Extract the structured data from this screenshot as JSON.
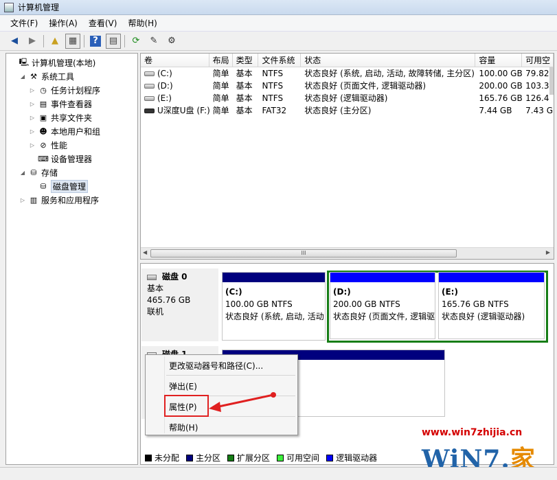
{
  "window": {
    "title": "计算机管理"
  },
  "menu": [
    "文件(F)",
    "操作(A)",
    "查看(V)",
    "帮助(H)"
  ],
  "tree": [
    {
      "label": "计算机管理(本地)",
      "indent": 0,
      "arrow": "",
      "icon": "computer-icon"
    },
    {
      "label": "系统工具",
      "indent": 1,
      "arrow": "◢",
      "icon": "tools-icon"
    },
    {
      "label": "任务计划程序",
      "indent": 2,
      "arrow": "▷",
      "icon": "clock-icon"
    },
    {
      "label": "事件查看器",
      "indent": 2,
      "arrow": "▷",
      "icon": "event-viewer-icon"
    },
    {
      "label": "共享文件夹",
      "indent": 2,
      "arrow": "▷",
      "icon": "shared-folder-icon"
    },
    {
      "label": "本地用户和组",
      "indent": 2,
      "arrow": "▷",
      "icon": "users-icon"
    },
    {
      "label": "性能",
      "indent": 2,
      "arrow": "▷",
      "icon": "performance-icon"
    },
    {
      "label": "设备管理器",
      "indent": 2,
      "arrow": "",
      "icon": "device-manager-icon"
    },
    {
      "label": "存储",
      "indent": 1,
      "arrow": "◢",
      "icon": "storage-icon"
    },
    {
      "label": "磁盘管理",
      "indent": 2,
      "arrow": "",
      "icon": "disk-management-icon",
      "selected": true
    },
    {
      "label": "服务和应用程序",
      "indent": 1,
      "arrow": "▷",
      "icon": "services-icon"
    }
  ],
  "volumes": {
    "headers": [
      "卷",
      "布局",
      "类型",
      "文件系统",
      "状态",
      "容量",
      "可用空"
    ],
    "rows": [
      [
        "(C:)",
        "简单",
        "基本",
        "NTFS",
        "状态良好 (系统, 启动, 活动, 故障转储, 主分区)",
        "100.00 GB",
        "79.82"
      ],
      [
        "(D:)",
        "简单",
        "基本",
        "NTFS",
        "状态良好 (页面文件, 逻辑驱动器)",
        "200.00 GB",
        "103.3"
      ],
      [
        "(E:)",
        "简单",
        "基本",
        "NTFS",
        "状态良好 (逻辑驱动器)",
        "165.76 GB",
        "126.4"
      ],
      [
        "U深度U盘 (F:)",
        "简单",
        "基本",
        "FAT32",
        "状态良好 (主分区)",
        "7.44 GB",
        "7.43 G"
      ]
    ],
    "scroll_thumb": "III"
  },
  "disk0": {
    "name": "磁盘 0",
    "type": "基本",
    "size": "465.76 GB",
    "state": "联机",
    "partitions": [
      {
        "name": "(C:)",
        "fs": "100.00 GB NTFS",
        "status": "状态良好 (系统, 启动, 活动"
      },
      {
        "name": "(D:)",
        "fs": "200.00 GB NTFS",
        "status": "状态良好 (页面文件, 逻辑驱"
      },
      {
        "name": "(E:)",
        "fs": "165.76 GB NTFS",
        "status": "状态良好 (逻辑驱动器)"
      }
    ]
  },
  "disk1": {
    "name": "磁盘 1"
  },
  "legend": [
    {
      "label": "未分配",
      "color": "#000000"
    },
    {
      "label": "主分区",
      "color": "#00007e"
    },
    {
      "label": "扩展分区",
      "color": "#167d16"
    },
    {
      "label": "可用空间",
      "color": "#3cf03c"
    },
    {
      "label": "逻辑驱动器",
      "color": "#0000ff"
    }
  ],
  "context_menu": {
    "change_letter": "更改驱动器号和路径(C)...",
    "eject": "弹出(E)",
    "properties": "属性(P)",
    "help": "帮助(H)"
  },
  "watermark": {
    "url": "www.win7zhijia.cn",
    "logo_a": "WiN7.",
    "logo_b": "家"
  }
}
